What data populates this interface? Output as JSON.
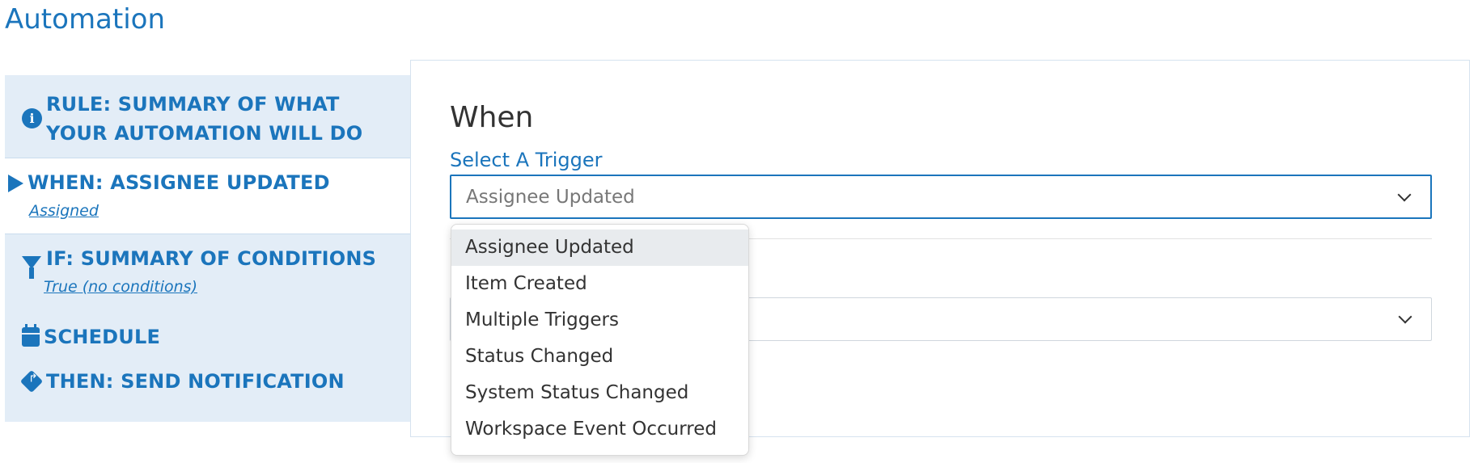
{
  "page": {
    "title": "Automation"
  },
  "sidebar": {
    "rule": {
      "label": "RULE: SUMMARY OF WHAT YOUR AUTOMATION WILL DO",
      "icon": "info-circle-icon"
    },
    "when": {
      "label": "WHEN: ASSIGNEE UPDATED",
      "sub": "Assigned",
      "icon": "caret-right-icon"
    },
    "if": {
      "label": "IF: SUMMARY OF CONDITIONS",
      "sub": "True (no conditions)",
      "icon": "filter-icon"
    },
    "schedule": {
      "label": "SCHEDULE",
      "icon": "calendar-icon"
    },
    "then": {
      "label": "THEN: SEND NOTIFICATION",
      "icon": "directions-icon"
    }
  },
  "main": {
    "heading": "When",
    "trigger_label": "Select A Trigger",
    "trigger_value": "Assignee Updated",
    "second_select_value": ""
  },
  "dropdown": {
    "options": [
      "Assignee Updated",
      "Item Created",
      "Multiple Triggers",
      "Status Changed",
      "System Status Changed",
      "Workspace Event Occurred"
    ],
    "selected": "Assignee Updated"
  },
  "colors": {
    "accent": "#1b75bc",
    "nav_bg": "#e3edf7",
    "text": "#333333",
    "option_hover": "#e8ebee"
  }
}
